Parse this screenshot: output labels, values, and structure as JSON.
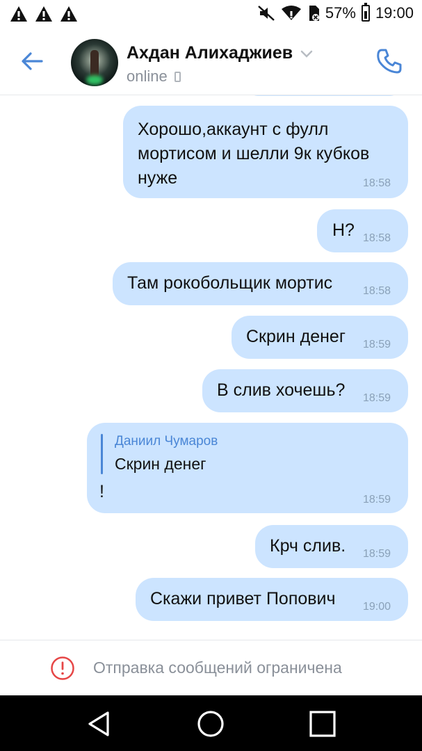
{
  "status_bar": {
    "battery": "57%",
    "time": "19:00"
  },
  "header": {
    "contact_name": "Ахдан Алихаджиев",
    "status": "online"
  },
  "messages": [
    {
      "text": "Хорошо,аккаунт с фулл мортисом и шелли 9к кубков нуже",
      "time": "18:58"
    },
    {
      "text": "Н?",
      "time": "18:58"
    },
    {
      "text": "Там рокобольщик мортис",
      "time": "18:58"
    },
    {
      "text": "Скрин денег",
      "time": "18:59"
    },
    {
      "text": "В слив хочешь?",
      "time": "18:59"
    },
    {
      "reply_author": "Даниил Чумаров",
      "reply_text": "Скрин денег",
      "text": "!",
      "time": "18:59"
    },
    {
      "text": "Крч слив.",
      "time": "18:59"
    },
    {
      "text": "Скажи привет Попович",
      "time": "19:00"
    }
  ],
  "footer": {
    "restriction_text": "Отправка сообщений ограничена"
  },
  "colors": {
    "bubble": "#cce4ff",
    "accent": "#4a86d6",
    "warning": "#e64646"
  }
}
